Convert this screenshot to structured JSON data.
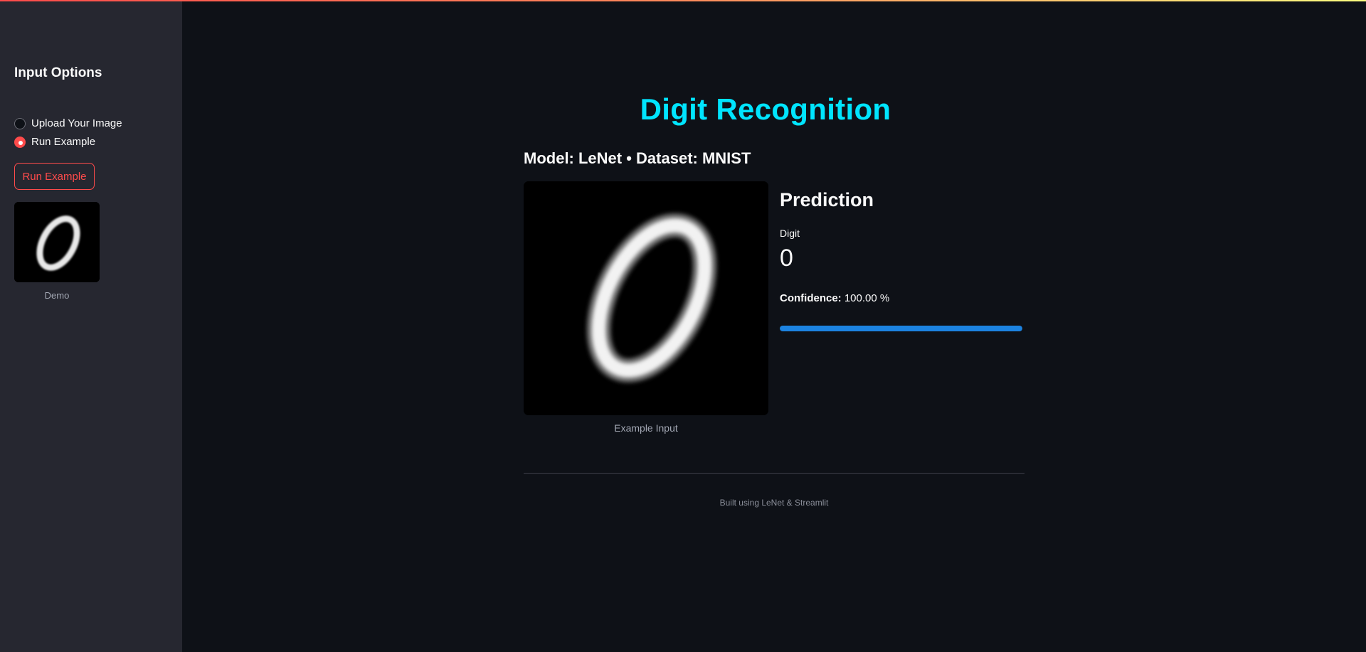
{
  "sidebar": {
    "title": "Input Options",
    "options": [
      {
        "label": "Upload Your Image",
        "selected": false
      },
      {
        "label": "Run Example",
        "selected": true
      }
    ],
    "run_button_label": "Run Example",
    "demo_caption": "Demo"
  },
  "main": {
    "title": "Digit Recognition",
    "model_line": "Model: LeNet  •  Dataset: MNIST",
    "example_caption": "Example Input",
    "prediction_heading": "Prediction",
    "metric_label": "Digit",
    "metric_value": "0",
    "confidence_label": "Confidence:",
    "confidence_value": "100.00 %",
    "confidence_fraction": 1.0,
    "footer": "Built using LeNet & Streamlit"
  },
  "colors": {
    "accent": "#ff4b4b",
    "title": "#00e5ff",
    "progress": "#1c83e1",
    "background": "#0e1117",
    "sidebar": "#262730"
  }
}
